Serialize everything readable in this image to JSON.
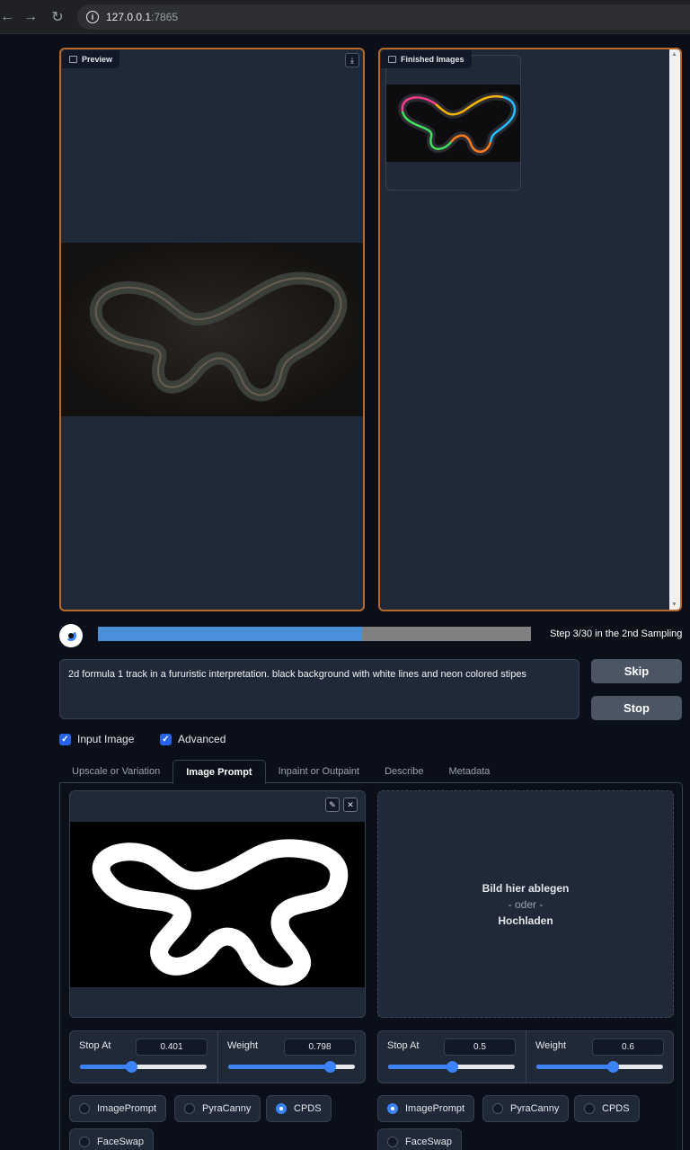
{
  "browser": {
    "url_host": "127.0.0.1",
    "url_port": ":7865"
  },
  "preview": {
    "label": "Preview"
  },
  "finished": {
    "label": "Finished Images"
  },
  "progress": {
    "fraction": 0.61,
    "text": "Step 3/30 in the 2nd Sampling"
  },
  "prompt": {
    "text": "2d formula 1 track in a fururistic interpretation. black background with white lines and neon colored stipes"
  },
  "buttons": {
    "skip": "Skip",
    "stop": "Stop"
  },
  "checkboxes": {
    "input_image": {
      "label": "Input Image",
      "checked": true
    },
    "advanced": {
      "label": "Advanced",
      "checked": true
    }
  },
  "tabs": [
    "Upscale or Variation",
    "Image Prompt",
    "Inpaint or Outpaint",
    "Describe",
    "Metadata"
  ],
  "active_tab": "Image Prompt",
  "dropzone": {
    "line1": "Bild hier ablegen",
    "line2": "- oder -",
    "line3": "Hochladen"
  },
  "slots": [
    {
      "stop_at_label": "Stop At",
      "stop_at": "0.401",
      "weight_label": "Weight",
      "weight": "0.798",
      "types": [
        "ImagePrompt",
        "PyraCanny",
        "CPDS",
        "FaceSwap"
      ],
      "selected": "CPDS"
    },
    {
      "stop_at_label": "Stop At",
      "stop_at": "0.5",
      "weight_label": "Weight",
      "weight": "0.6",
      "types": [
        "ImagePrompt",
        "PyraCanny",
        "CPDS",
        "FaceSwap"
      ],
      "selected": "ImagePrompt"
    }
  ],
  "colors": {
    "accent": "#3b82f6",
    "panel_border": "#b8692c",
    "progress": "#4a90d9"
  }
}
